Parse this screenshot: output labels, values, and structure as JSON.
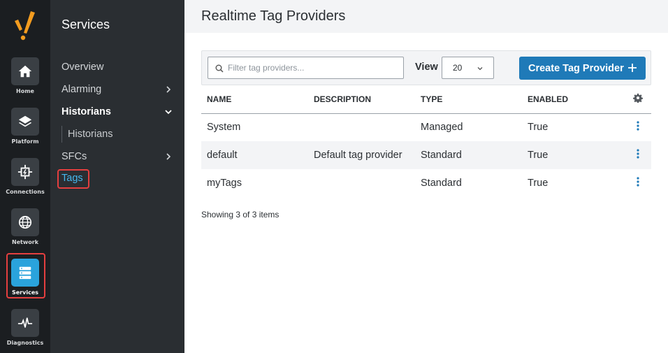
{
  "rail": {
    "items": [
      {
        "label": "Home",
        "icon": "home-icon"
      },
      {
        "label": "Platform",
        "icon": "layers-icon"
      },
      {
        "label": "Connections",
        "icon": "connections-icon"
      },
      {
        "label": "Network",
        "icon": "globe-icon"
      },
      {
        "label": "Services",
        "icon": "server-icon",
        "active": true
      },
      {
        "label": "Diagnostics",
        "icon": "pulse-icon"
      }
    ],
    "accent": "#2aa3dc",
    "highlight": "#e43f3f"
  },
  "subnav": {
    "title": "Services",
    "items": [
      {
        "label": "Overview"
      },
      {
        "label": "Alarming"
      },
      {
        "label": "Historians"
      },
      {
        "label": "Historians"
      },
      {
        "label": "SFCs"
      },
      {
        "label": "Tags"
      }
    ]
  },
  "main": {
    "title": "Realtime Tag Providers",
    "search": {
      "placeholder": "Filter tag providers..."
    },
    "view": {
      "label": "View",
      "value": "20"
    },
    "create_button": "Create Tag Provider",
    "table": {
      "headers": [
        "NAME",
        "DESCRIPTION",
        "TYPE",
        "ENABLED"
      ],
      "rows": [
        {
          "name": "System",
          "description": "",
          "type": "Managed",
          "enabled": "True"
        },
        {
          "name": "default",
          "description": "Default tag provider",
          "type": "Standard",
          "enabled": "True"
        },
        {
          "name": "myTags",
          "description": "",
          "type": "Standard",
          "enabled": "True"
        }
      ]
    },
    "footer": "Showing 3 of 3 items",
    "button_color": "#1f7ab8"
  }
}
